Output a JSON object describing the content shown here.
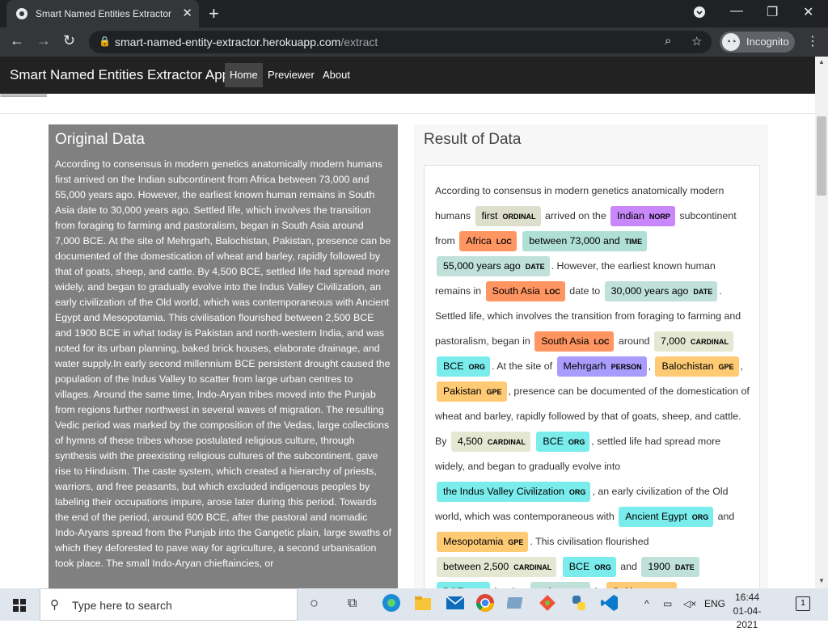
{
  "browser": {
    "tab_title": "Smart Named Entities Extractor A",
    "tab_close": "✕",
    "new_tab": "+",
    "url_host": "smart-named-entity-extractor.herokuapp.com",
    "url_path": "/extract",
    "incognito_label": "Incognito",
    "icons": [
      "back-arrow-icon",
      "forward-arrow-icon",
      "reload-icon",
      "lock-icon",
      "zoom-icon",
      "star-icon",
      "incognito-icon",
      "menu-icon"
    ]
  },
  "app": {
    "brand": "Smart Named Entities Extractor App",
    "nav": [
      "Home",
      "Previewer",
      "About"
    ],
    "active_nav": "Home",
    "divider_text": "============="
  },
  "original": {
    "title": "Original Data",
    "text": "According to consensus in modern genetics anatomically modern humans first arrived on the Indian subcontinent from Africa between 73,000 and 55,000 years ago. However, the earliest known human remains in South Asia date to 30,000 years ago. Settled life, which involves the transition from foraging to farming and pastoralism, began in South Asia around 7,000 BCE. At the site of Mehrgarh, Balochistan, Pakistan, presence can be documented of the domestication of wheat and barley, rapidly followed by that of goats, sheep, and cattle. By 4,500 BCE, settled life had spread more widely, and began to gradually evolve into the Indus Valley Civilization, an early civilization of the Old world, which was contemporaneous with Ancient Egypt and Mesopotamia. This civilisation flourished between 2,500 BCE and 1900 BCE in what today is Pakistan and north-western India, and was noted for its urban planning, baked brick houses, elaborate drainage, and water supply.In early second millennium BCE persistent drought caused the population of the Indus Valley to scatter from large urban centres to villages. Around the same time, Indo-Aryan tribes moved into the Punjab from regions further northwest in several waves of migration. The resulting Vedic period was marked by the composition of the Vedas, large collections of hymns of these tribes whose postulated religious culture, through synthesis with the preexisting religious cultures of the subcontinent, gave rise to Hinduism. The caste system, which created a hierarchy of priests, warriors, and free peasants, but which excluded indigenous peoples by labeling their occupations impure, arose later during this period. Towards the end of the period, around 600 BCE, after the pastoral and nomadic Indo-Aryans spread from the Punjab into the Gangetic plain, large swaths of which they deforested to pave way for agriculture, a second urbanisation took place. The small Indo-Aryan chieftaincies, or"
  },
  "result": {
    "title": "Result of Data",
    "colors": {
      "ORDINAL": "#dddfcc",
      "NORP": "#c887fb",
      "LOC": "#ff9561",
      "TIME": "#b0dfd5",
      "DATE": "#bfe1d9",
      "CARDINAL": "#e4e7d2",
      "ORG": "#7aecec",
      "PERSON": "#aa9cfc",
      "GPE": "#feca74"
    },
    "segments": [
      {
        "t": "According to consensus in modern genetics anatomically modern humans "
      },
      {
        "e": "first",
        "l": "ORDINAL"
      },
      {
        "t": " arrived on the "
      },
      {
        "e": "Indian",
        "l": "NORP"
      },
      {
        "t": " subcontinent from "
      },
      {
        "e": "Africa",
        "l": "LOC"
      },
      {
        "t": " "
      },
      {
        "e": "between 73,000 and",
        "l": "TIME"
      },
      {
        "t": " "
      },
      {
        "e": "55,000 years ago",
        "l": "DATE"
      },
      {
        "t": ". However, the earliest known human remains in "
      },
      {
        "e": "South Asia",
        "l": "LOC"
      },
      {
        "t": " date to "
      },
      {
        "e": "30,000 years ago",
        "l": "DATE"
      },
      {
        "t": ". Settled life, which involves the transition from foraging to farming and pastoralism, began in "
      },
      {
        "e": "South Asia",
        "l": "LOC"
      },
      {
        "t": " around "
      },
      {
        "e": "7,000",
        "l": "CARDINAL"
      },
      {
        "t": " "
      },
      {
        "e": "BCE",
        "l": "ORG"
      },
      {
        "t": ". At the site of "
      },
      {
        "e": "Mehrgarh",
        "l": "PERSON"
      },
      {
        "t": ", "
      },
      {
        "e": "Balochistan",
        "l": "GPE"
      },
      {
        "t": ", "
      },
      {
        "e": "Pakistan",
        "l": "GPE"
      },
      {
        "t": ", presence can be documented of the domestication of wheat and barley, rapidly followed by that of goats, sheep, and cattle. By "
      },
      {
        "e": "4,500",
        "l": "CARDINAL"
      },
      {
        "t": " "
      },
      {
        "e": "BCE",
        "l": "ORG"
      },
      {
        "t": ", settled life had spread more widely, and began to gradually evolve into "
      },
      {
        "e": "the Indus Valley Civilization",
        "l": "ORG"
      },
      {
        "t": ", an early civilization of the Old world, which was contemporaneous with "
      },
      {
        "e": "Ancient Egypt",
        "l": "ORG"
      },
      {
        "t": " and "
      },
      {
        "e": "Mesopotamia",
        "l": "GPE"
      },
      {
        "t": ". This civilisation flourished "
      },
      {
        "e": "between 2,500",
        "l": "CARDINAL"
      },
      {
        "t": " "
      },
      {
        "e": "BCE",
        "l": "ORG"
      },
      {
        "t": " and "
      },
      {
        "e": "1900",
        "l": "DATE"
      },
      {
        "t": " "
      },
      {
        "e": "BCE",
        "l": "ORG"
      },
      {
        "t": " in what "
      },
      {
        "e": "today",
        "l": "DATE"
      },
      {
        "t": " is "
      },
      {
        "e": "Pakistan",
        "l": "GPE"
      }
    ]
  },
  "taskbar": {
    "search_placeholder": "Type here to search",
    "language": "ENG",
    "time": "16:44",
    "date": "01-04-2021",
    "notification_count": "1",
    "pinned_apps": [
      "task-view-icon",
      "edge-icon",
      "file-explorer-icon",
      "mail-icon",
      "chrome-icon",
      "files-icon",
      "git-icon",
      "python-icon",
      "vscode-icon"
    ]
  }
}
